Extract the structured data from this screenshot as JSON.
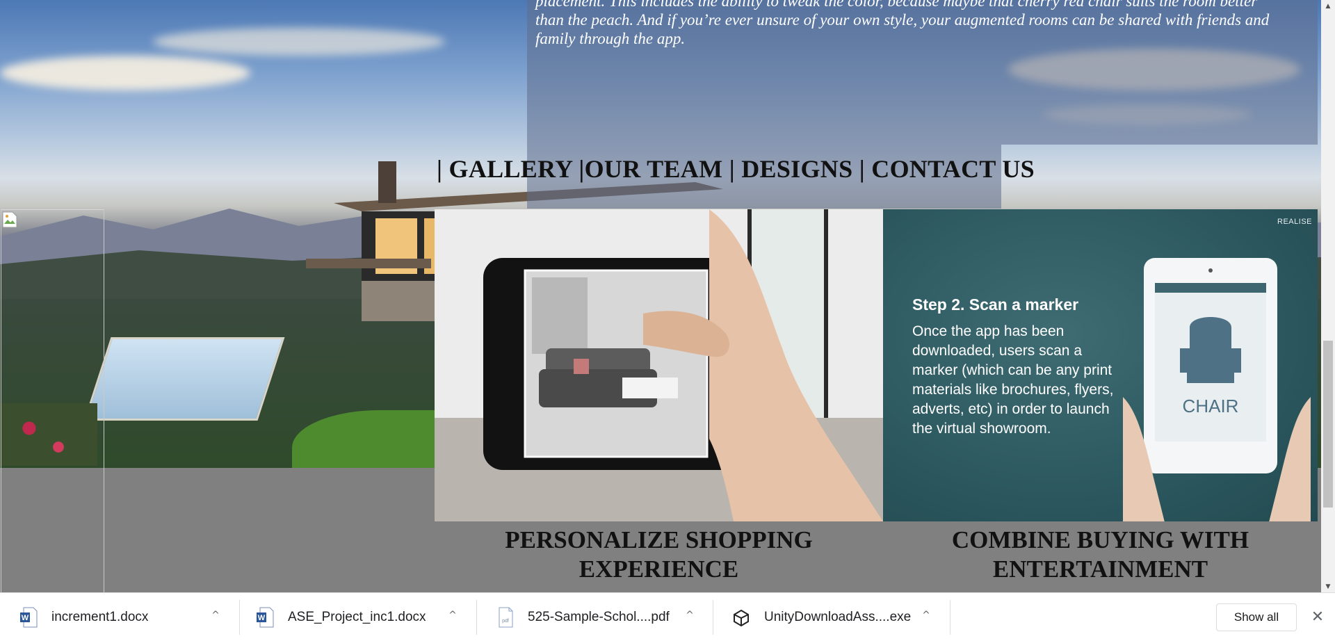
{
  "about": {
    "text_line1": "placement. This includes the ability to tweak the color, because maybe that cherry red chair suits the room better",
    "text_line2": "than the peach. And if you’re ever unsure of your own style, your augmented rooms can be shared with friends and",
    "text_line3": "family through the app."
  },
  "nav": {
    "sep": "|",
    "items": [
      {
        "label": "GALLERY"
      },
      {
        "label": "OUR TEAM"
      },
      {
        "label": "DESIGNS"
      },
      {
        "label": "CONTACT US"
      }
    ]
  },
  "step_tile": {
    "brand": "REALISE",
    "title": "Step 2. Scan a marker",
    "body": "Once the app has been downloaded, users scan a marker (which can be any print materials like brochures, flyers, adverts, etc) in order to launch the virtual showroom.",
    "tablet_label": "CHAIR"
  },
  "captions": {
    "personalize": "PERSONALIZE SHOPPING EXPERIENCE",
    "combine": "COMBINE BUYING WITH ENTERTAINMENT"
  },
  "downloads": {
    "items": [
      {
        "name": "increment1.docx",
        "icon": "word-doc-icon"
      },
      {
        "name": "ASE_Project_inc1.docx",
        "icon": "word-doc-icon"
      },
      {
        "name": "525-Sample-Schol....pdf",
        "icon": "pdf-icon"
      },
      {
        "name": "UnityDownloadAss....exe",
        "icon": "unity-icon"
      }
    ],
    "show_all": "Show all",
    "caret": "^",
    "close": "✕"
  },
  "colors": {
    "panel": "#5f6e8c",
    "step_bg": "#2d5960",
    "page_gray": "#808080"
  }
}
